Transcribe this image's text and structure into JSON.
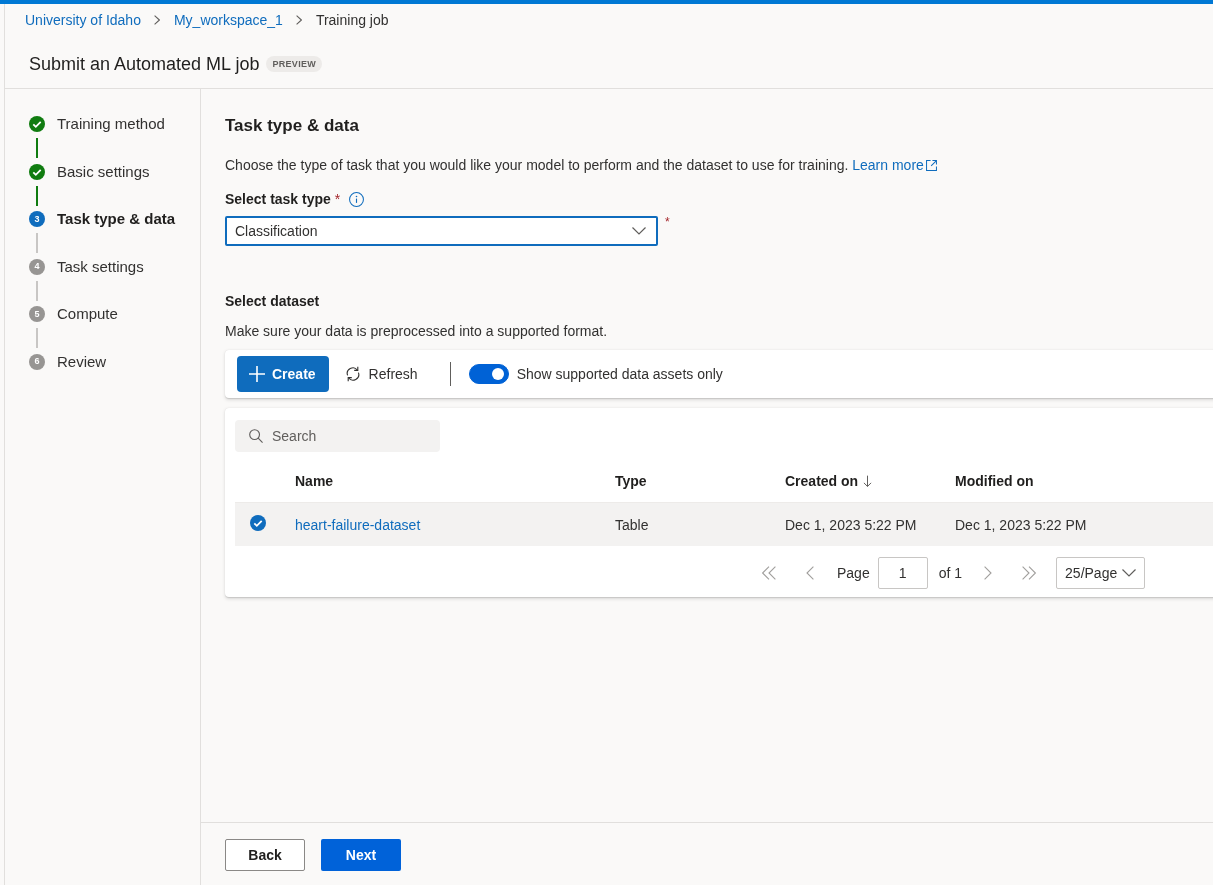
{
  "breadcrumb": [
    {
      "label": "University of Idaho",
      "kind": "link"
    },
    {
      "label": "My_workspace_1",
      "kind": "link"
    },
    {
      "label": "Training job",
      "kind": "current"
    }
  ],
  "header": {
    "title": "Submit an Automated ML job",
    "badge": "PREVIEW"
  },
  "steps": [
    {
      "label": "Training method",
      "completed": true,
      "selected": false
    },
    {
      "label": "Basic settings",
      "completed": true,
      "selected": false
    },
    {
      "number": "3",
      "label": "Task type & data",
      "completed": false,
      "selected": true
    },
    {
      "number": "4",
      "label": "Task settings",
      "completed": false,
      "selected": false
    },
    {
      "number": "5",
      "label": "Compute",
      "completed": false,
      "selected": false
    },
    {
      "number": "6",
      "label": "Review",
      "completed": false,
      "selected": false
    }
  ],
  "task": {
    "title": "Task type & data",
    "description": "Choose the type of task that you would like your model to perform and the dataset to use for training.",
    "learn_more": "Learn more",
    "task_type": {
      "label": "Select task type",
      "label_marker": "*",
      "value": "Classification",
      "focused": true,
      "field_marker": "*"
    }
  },
  "dataset": {
    "title": "Select dataset",
    "hint": "Make sure your data is preprocessed into a supported format.",
    "toolbar": {
      "create": "Create",
      "refresh": "Refresh",
      "toggle": {
        "label": "Show supported data assets only",
        "on": true
      }
    },
    "search": {
      "placeholder": "Search"
    },
    "table": {
      "columns": [
        {
          "label": "Name",
          "kind": "link",
          "sorted": false
        },
        {
          "label": "Type",
          "kind": "text",
          "sorted": false
        },
        {
          "label": "Created on",
          "kind": "text",
          "sorted": true
        },
        {
          "label": "Modified on",
          "kind": "text",
          "sorted": false
        }
      ],
      "rows": [
        {
          "selected": true,
          "cells": [
            "heart-failure-dataset",
            "Table",
            "Dec 1, 2023 5:22 PM",
            "Dec 1, 2023 5:22 PM"
          ]
        }
      ]
    },
    "pagination": {
      "nav_buttons": [
        {
          "kind": "first",
          "disabled": true
        },
        {
          "kind": "previous",
          "disabled": true
        },
        {
          "kind": "next",
          "disabled": true
        },
        {
          "kind": "last",
          "disabled": true
        }
      ],
      "page_label": "Page",
      "page": "1",
      "total": "of 1",
      "page_size": "25/Page"
    }
  },
  "footer": {
    "buttons": [
      {
        "label": "Back",
        "kind": "secondary"
      },
      {
        "label": "Next",
        "kind": "primary"
      }
    ]
  }
}
